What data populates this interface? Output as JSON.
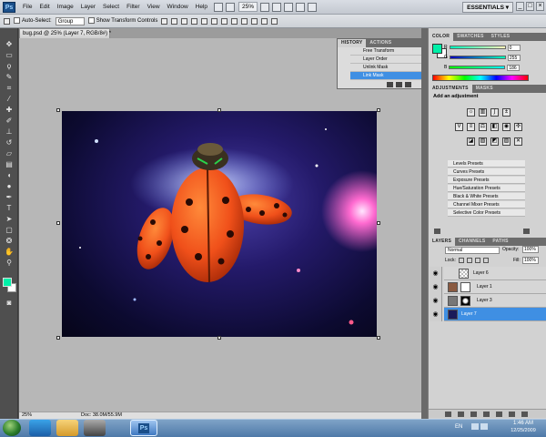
{
  "menubar": {
    "logo": "Ps",
    "items": [
      "File",
      "Edit",
      "Image",
      "Layer",
      "Select",
      "Filter",
      "View",
      "Window",
      "Help"
    ],
    "zoom": "25%",
    "workspace": "ESSENTIALS ▾",
    "controls": [
      "_",
      "□",
      "×"
    ]
  },
  "options": {
    "auto_select_label": "Auto-Select:",
    "auto_select_target": "Group",
    "transform_label": "Show Transform Controls"
  },
  "document": {
    "tab_title": "bug.psd @ 25% (Layer 7, RGB/8#) *",
    "status_zoom": "25%",
    "status_doc": "Doc: 38.0M/55.9M"
  },
  "history": {
    "tabs": [
      "HISTORY",
      "ACTIONS"
    ],
    "rows": [
      "Free Transform",
      "Layer Order",
      "Unlink Mask",
      "Link Mask"
    ],
    "selected": 3
  },
  "color_panel": {
    "tabs": [
      "COLOR",
      "SWATCHES",
      "STYLES"
    ],
    "channels": [
      {
        "label": "R",
        "value": "0"
      },
      {
        "label": "G",
        "value": "255"
      },
      {
        "label": "B",
        "value": "186"
      }
    ],
    "fg": "#00f0a8"
  },
  "adjustments": {
    "tabs": [
      "ADJUSTMENTS",
      "MASKS"
    ],
    "heading": "Add an adjustment",
    "presets": [
      "Levels Presets",
      "Curves Presets",
      "Exposure Presets",
      "Hue/Saturation Presets",
      "Black & White Presets",
      "Channel Mixer Presets",
      "Selective Color Presets"
    ]
  },
  "layers": {
    "tabs": [
      "LAYERS",
      "CHANNELS",
      "PATHS"
    ],
    "blend_mode": "Normal",
    "opacity_label": "Opacity:",
    "opacity": "100%",
    "lock_label": "Lock:",
    "fill_label": "Fill:",
    "fill": "100%",
    "rows": [
      {
        "name": "Layer 6"
      },
      {
        "name": "Layer 1"
      },
      {
        "name": "Layer 3"
      },
      {
        "name": "Layer 7"
      }
    ],
    "selected": 3
  },
  "taskbar": {
    "lang": "EN",
    "time": "1:46 AM",
    "date": "12/25/2009"
  },
  "colors": {
    "selection": "#3f8fe3",
    "foreground": "#00f0a8"
  }
}
